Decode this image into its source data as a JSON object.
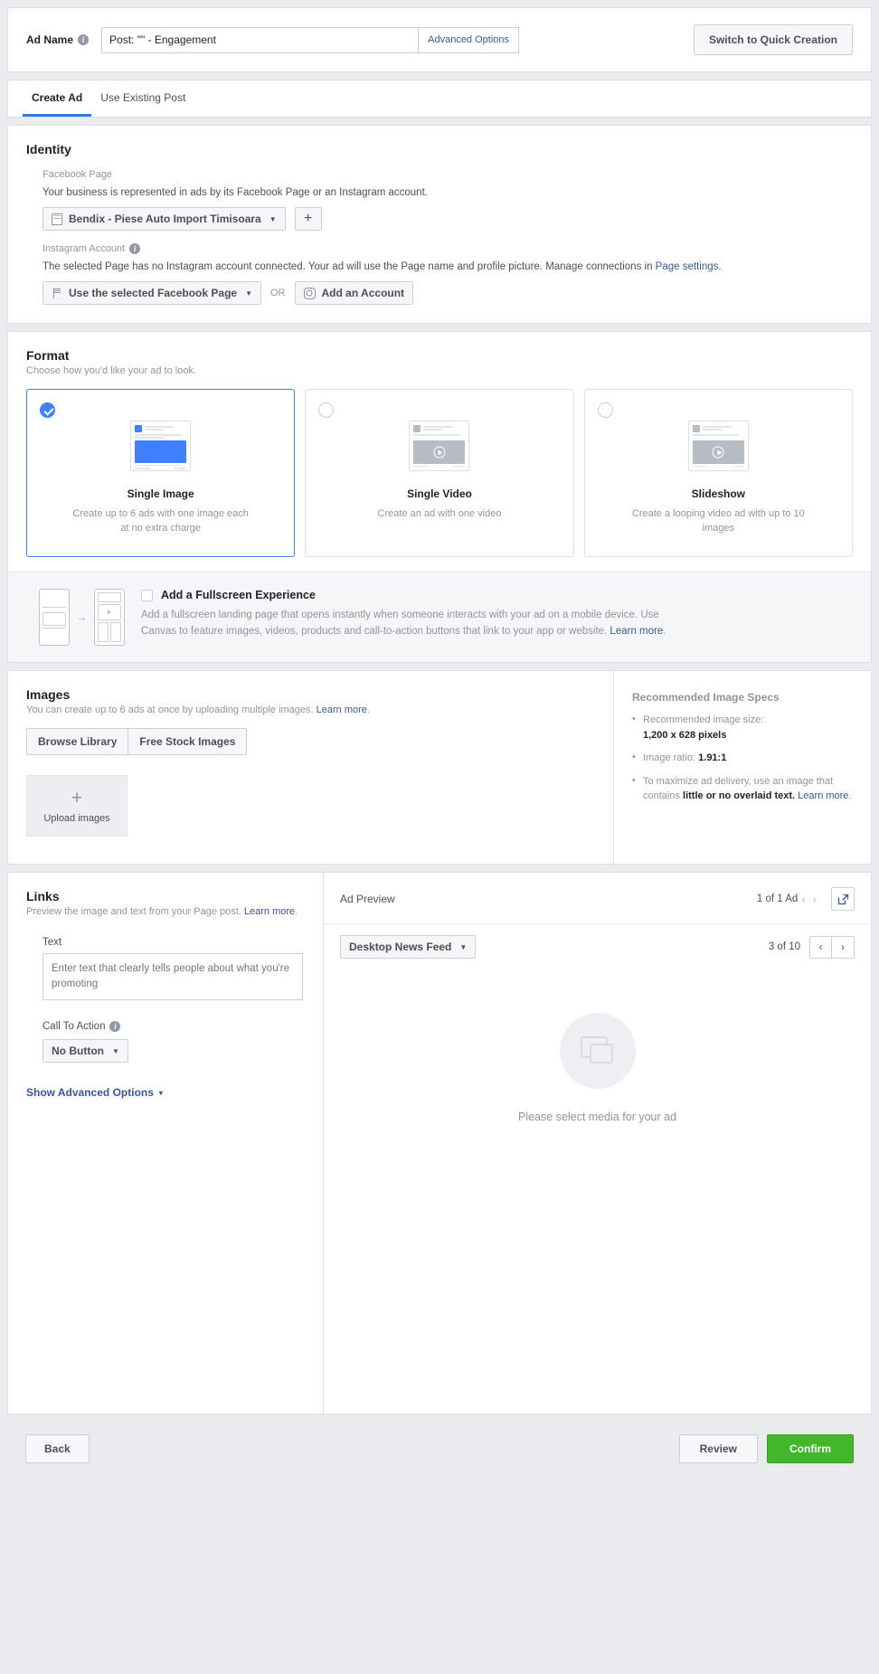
{
  "adname": {
    "label": "Ad Name",
    "value": "Post: \"\" - Engagement",
    "advanced_options": "Advanced Options",
    "switch_quick": "Switch to Quick Creation"
  },
  "tabs": [
    {
      "label": "Create Ad",
      "active": true
    },
    {
      "label": "Use Existing Post",
      "active": false
    }
  ],
  "identity": {
    "title": "Identity",
    "facebook_page_label": "Facebook Page",
    "facebook_page_desc": "Your business is represented in ads by its Facebook Page or an Instagram account.",
    "page_selected": "Bendix - Piese Auto Import Timisoara",
    "add_page_button": "+",
    "instagram_label": "Instagram Account",
    "instagram_desc": "The selected Page has no Instagram account connected. Your ad will use the Page name and profile picture. Manage connections in ",
    "instagram_desc_link": "Page settings",
    "instagram_desc_end": ".",
    "instagram_selected": "Use the selected Facebook Page",
    "or": "OR",
    "add_account": "Add an Account"
  },
  "format": {
    "title": "Format",
    "subtitle": "Choose how you'd like your ad to look.",
    "cards": [
      {
        "name": "Single Image",
        "desc": "Create up to 6 ads with one image each at no extra charge",
        "selected": true
      },
      {
        "name": "Single Video",
        "desc": "Create an ad with one video",
        "selected": false
      },
      {
        "name": "Slideshow",
        "desc": "Create a looping video ad with up to 10 images",
        "selected": false
      }
    ],
    "fullscreen": {
      "title": "Add a Fullscreen Experience",
      "desc": "Add a fullscreen landing page that opens instantly when someone interacts with your ad on a mobile device. Use Canvas to feature images, videos, products and call-to-action buttons that link to your app or website. ",
      "learn_more": "Learn more",
      "desc_end": ".",
      "checked": false
    }
  },
  "images": {
    "title": "Images",
    "subtitle": "You can create up to 6 ads at once by uploading multiple images. ",
    "subtitle_link": "Learn more",
    "subtitle_end": ".",
    "browse_library": "Browse Library",
    "free_stock": "Free Stock Images",
    "upload_label": "Upload images",
    "specs_title": "Recommended Image Specs",
    "specs": [
      {
        "text": "Recommended image size:",
        "bold": "1,200 x 628 pixels"
      },
      {
        "text": "Image ratio: ",
        "bold": "1.91:1"
      },
      {
        "text": "To maximize ad delivery, use an image that contains ",
        "bold": "little or no overlaid text.",
        "link": "Learn more",
        "end": "."
      }
    ]
  },
  "links": {
    "title": "Links",
    "subtitle": "Preview the image and text from your Page post. ",
    "subtitle_link": "Learn more",
    "subtitle_end": ".",
    "text_label": "Text",
    "text_placeholder": "Enter text that clearly tells people about what you're promoting",
    "text_value": "",
    "cta_label": "Call To Action",
    "cta_value": "No Button",
    "show_advanced": "Show Advanced Options"
  },
  "preview": {
    "title": "Ad Preview",
    "ad_count": "1 of 1 Ad",
    "placement": "Desktop News Feed",
    "page_count": "3 of 10",
    "placeholder_text": "Please select media for your ad"
  },
  "footer": {
    "back": "Back",
    "review": "Review",
    "confirm": "Confirm"
  },
  "colors": {
    "accent_blue": "#3578e5",
    "link_blue": "#385898",
    "selected_blue": "#4080ff",
    "confirm_green": "#42b72a"
  }
}
